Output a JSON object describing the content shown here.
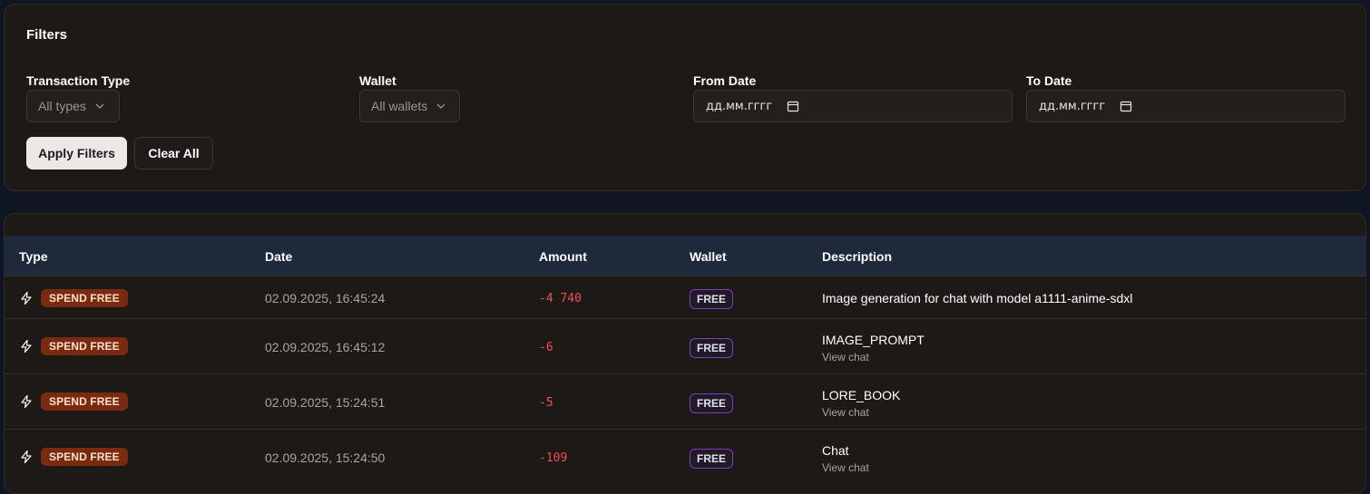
{
  "filters": {
    "title": "Filters",
    "transaction_type": {
      "label": "Transaction Type",
      "value": "All types"
    },
    "wallet": {
      "label": "Wallet",
      "value": "All wallets"
    },
    "from_date": {
      "label": "From Date",
      "value": "дд.мм.гггг"
    },
    "to_date": {
      "label": "To Date",
      "value": "дд.мм.гггг"
    },
    "apply_label": "Apply Filters",
    "clear_label": "Clear All"
  },
  "table": {
    "columns": [
      "Type",
      "Date",
      "Amount",
      "Wallet",
      "Description"
    ],
    "rows": [
      {
        "type": "SPEND FREE",
        "date": "02.09.2025, 16:45:24",
        "amount": "-4 740",
        "wallet": "FREE",
        "description": "Image generation for chat with model a1111-anime-sdxl",
        "link": ""
      },
      {
        "type": "SPEND FREE",
        "date": "02.09.2025, 16:45:12",
        "amount": "-6",
        "wallet": "FREE",
        "description": "IMAGE_PROMPT",
        "link": "View chat"
      },
      {
        "type": "SPEND FREE",
        "date": "02.09.2025, 15:24:51",
        "amount": "-5",
        "wallet": "FREE",
        "description": "LORE_BOOK",
        "link": "View chat"
      },
      {
        "type": "SPEND FREE",
        "date": "02.09.2025, 15:24:50",
        "amount": "-109",
        "wallet": "FREE",
        "description": "Chat",
        "link": "View chat"
      }
    ]
  },
  "icons": {
    "type_icon": "bolt-icon",
    "select_icon": "chevron-down-icon",
    "date_icon": "calendar-icon"
  },
  "colors": {
    "spend_badge_bg": "#7a2a10",
    "amount_negative": "#f05252",
    "wallet_badge_border": "#7e3ec4"
  }
}
